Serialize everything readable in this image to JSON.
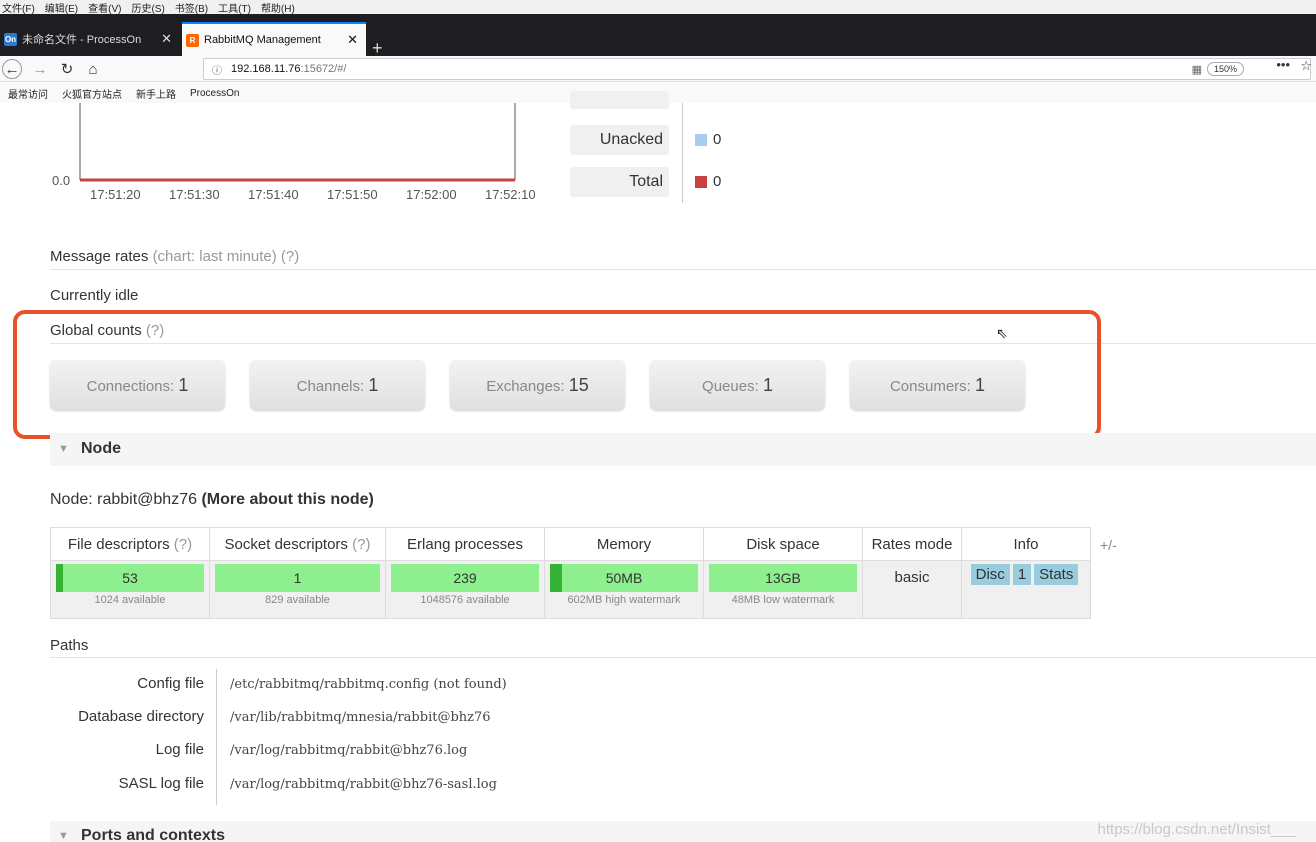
{
  "browser": {
    "menu": [
      "文件(F)",
      "编辑(E)",
      "查看(V)",
      "历史(S)",
      "书签(B)",
      "工具(T)",
      "帮助(H)"
    ],
    "tabs": [
      {
        "label": "未命名文件 - ProcessOn",
        "fav": "On"
      },
      {
        "label": "RabbitMQ Management",
        "fav": "R"
      }
    ],
    "url_host": "192.168.11.76",
    "url_rest": ":15672/#/",
    "zoom": "150%",
    "bookmarks": [
      "最常访问",
      "火狐官方站点",
      "新手上路",
      "ProcessOn"
    ]
  },
  "chart": {
    "y_min_label": "0.0",
    "x_ticks": [
      "17:51:20",
      "17:51:30",
      "17:51:40",
      "17:51:50",
      "17:52:00",
      "17:52:10"
    ]
  },
  "legend": [
    {
      "label": "Unacked",
      "value": "0",
      "color": "#aaccee"
    },
    {
      "label": "Total",
      "value": "0",
      "color": "#c84040"
    }
  ],
  "message_rates": {
    "label": "Message rates",
    "hint": "(chart: last minute) (?)"
  },
  "idle_text": "Currently idle",
  "global_counts": {
    "label": "Global counts",
    "hint": "(?)",
    "items": [
      {
        "label": "Connections:",
        "value": "1"
      },
      {
        "label": "Channels:",
        "value": "1"
      },
      {
        "label": "Exchanges:",
        "value": "15"
      },
      {
        "label": "Queues:",
        "value": "1"
      },
      {
        "label": "Consumers:",
        "value": "1"
      }
    ]
  },
  "node": {
    "section_title": "Node",
    "line_prefix": "Node: rabbit@bhz76",
    "more_link": "(More about this node)",
    "headers": [
      "File descriptors",
      "Socket descriptors",
      "Erlang processes",
      "Memory",
      "Disk space",
      "Rates mode",
      "Info"
    ],
    "header_hint": "(?)",
    "cells": [
      {
        "value": "53",
        "sub": "1024 available",
        "fill_fraction": 0.05
      },
      {
        "value": "1",
        "sub": "829 available",
        "fill_fraction": 0.0
      },
      {
        "value": "239",
        "sub": "1048576 available",
        "fill_fraction": 0.0
      },
      {
        "value": "50MB",
        "sub": "602MB high watermark",
        "fill_fraction": 0.08
      },
      {
        "value": "13GB",
        "sub": "48MB low watermark",
        "fill_fraction": 0.0
      }
    ],
    "rates_mode": "basic",
    "info_buttons": [
      "Disc",
      "1",
      "Stats"
    ],
    "plus_minus": "+/-"
  },
  "paths": {
    "label": "Paths",
    "rows": [
      {
        "key": "Config file",
        "value": "/etc/rabbitmq/rabbitmq.config (not found)"
      },
      {
        "key": "Database directory",
        "value": "/var/lib/rabbitmq/mnesia/rabbit@bhz76"
      },
      {
        "key": "Log file",
        "value": "/var/log/rabbitmq/rabbit@bhz76.log"
      },
      {
        "key": "SASL log file",
        "value": "/var/log/rabbitmq/rabbit@bhz76-sasl.log"
      }
    ]
  },
  "ports_title": "Ports and contexts",
  "watermark": "https://blog.csdn.net/Insist___"
}
